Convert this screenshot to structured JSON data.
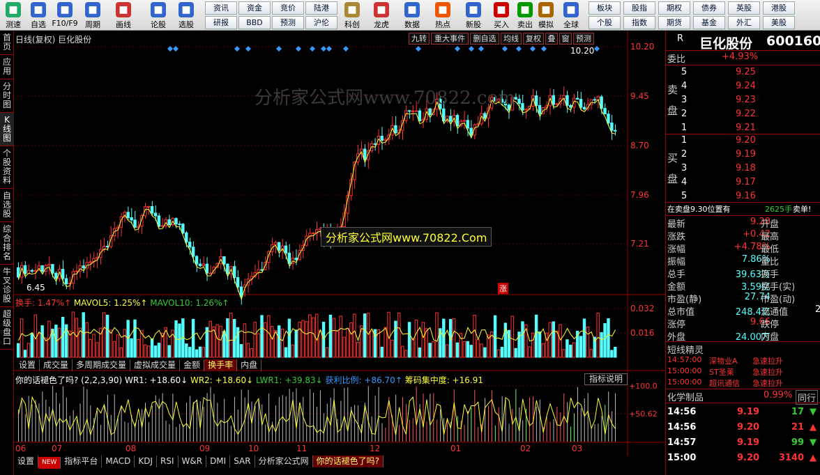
{
  "toolbar": {
    "items": [
      {
        "label": "测速",
        "icon": "speed-test-icon",
        "color": "#2a6"
      },
      {
        "label": "自选",
        "icon": "star-icon",
        "color": "#36c"
      },
      {
        "label": "F10/F9",
        "icon": "f10-icon",
        "color": "#36c"
      },
      {
        "label": "周期",
        "icon": "clock-icon",
        "color": "#36c"
      },
      {
        "label": "画线",
        "icon": "pencil-icon",
        "color": "#c33"
      },
      {
        "label": "论股",
        "icon": "forum-icon",
        "color": "#36c"
      },
      {
        "label": "选股",
        "icon": "stock-pick-icon",
        "color": "#36c"
      },
      {
        "label": "科创",
        "icon": "star-board-icon",
        "color": "#a83"
      },
      {
        "label": "龙虎",
        "icon": "dragon-tiger-icon",
        "color": "#c33"
      },
      {
        "label": "数据",
        "icon": "data-icon",
        "color": "#36c"
      },
      {
        "label": "热点",
        "icon": "hot-icon",
        "color": "#e50"
      },
      {
        "label": "新股",
        "icon": "ipo-icon",
        "color": "#36c"
      },
      {
        "label": "买入",
        "icon": "buy-icon",
        "color": "#c00"
      },
      {
        "label": "卖出",
        "icon": "sell-icon",
        "color": "#090"
      },
      {
        "label": "模拟",
        "icon": "simulate-icon",
        "color": "#a60"
      },
      {
        "label": "全球",
        "icon": "globe-icon",
        "color": "#36c"
      }
    ],
    "grid1": [
      [
        "资讯",
        "研报"
      ],
      [
        "资金",
        "BBD"
      ],
      [
        "竞价",
        "预测"
      ],
      [
        "陆港",
        "沪伦"
      ]
    ],
    "grid2": [
      [
        "板块",
        "个股"
      ],
      [
        "股指",
        "指数"
      ],
      [
        "期权",
        "期货"
      ],
      [
        "债券",
        "基金"
      ],
      [
        "英股",
        "外汇"
      ],
      [
        "港股",
        "美股"
      ]
    ]
  },
  "side_tabs": [
    "首页",
    "应用",
    "分时图",
    "K线图",
    "个股资料",
    "自选股",
    "综合排名",
    "牛叉诊股",
    "超级盘口"
  ],
  "chart_header": {
    "title": "日线(复权) 巨化股份",
    "buttons": [
      "九转",
      "重大事件",
      "删自选",
      "均线",
      "复权",
      "叠",
      "窗",
      "预测"
    ]
  },
  "watermark": "分析家公式网www.70822.com",
  "banner": "分析家公式网www.70822.Com",
  "zhang": "涨",
  "volume_legend": {
    "a": "换手: 1.47%↑",
    "b": "MAVOL5: 1.25%↑",
    "c": "MAVOL10: 1.26%↑"
  },
  "tabs1": [
    "设置",
    "成交量",
    "多周期成交量",
    "虚拟成交量",
    "金额",
    "换手率",
    "内盘"
  ],
  "ind_legend": {
    "a": "你的话褪色了吗? (2,2,3,90) WR1: +18.60↓",
    "b": "WR2: +18.60↓",
    "c": "LWR1: +39.83↓",
    "d": "获利比例: +86.70↑",
    "e": "筹码集中度: +16.91"
  },
  "ind_button": "指标说明",
  "tabs2": [
    "设置",
    "NEW",
    "指标平台",
    "MACD",
    "KDJ",
    "RSI",
    "W&R",
    "DMI",
    "SAR",
    "分析家公式网",
    "你的话褪色了吗?"
  ],
  "chart_data": {
    "type": "candlestick",
    "y_ticks": [
      "10.20",
      "9.45",
      "8.70",
      "7.96",
      "7.21"
    ],
    "price_max": "10.20",
    "price_min": "6.45",
    "vol_ticks": [
      "0.032",
      "0.016"
    ],
    "ind_ticks": [
      "+100.0",
      "+50.62"
    ],
    "x_months": [
      "06",
      "07",
      "08",
      "09",
      "10",
      "11",
      "12",
      "01",
      "02",
      "03"
    ]
  },
  "quote": {
    "letter": "R",
    "name": "巨化股份",
    "code": "600160",
    "weibi_label": "委比",
    "weibi": "+4.93%",
    "sell_label": [
      "卖",
      "盘"
    ],
    "buy_label": [
      "买",
      "盘"
    ],
    "sell": [
      [
        "5",
        "9.25"
      ],
      [
        "4",
        "9.24"
      ],
      [
        "3",
        "9.23"
      ],
      [
        "2",
        "9.22"
      ],
      [
        "1",
        "9.21"
      ]
    ],
    "buy": [
      [
        "1",
        "9.20"
      ],
      [
        "2",
        "9.19"
      ],
      [
        "3",
        "9.18"
      ],
      [
        "4",
        "9.17"
      ],
      [
        "5",
        "9.16"
      ]
    ],
    "notice": "在卖盘9.30位置有",
    "notice_vol": "2625手",
    "notice_act": "卖单!",
    "stats": [
      [
        "最新",
        "9.20",
        "开盘",
        ""
      ],
      [
        "涨跌",
        "+0.42",
        "最高",
        ""
      ],
      [
        "涨幅",
        "+4.78%",
        "最低",
        ""
      ],
      [
        "振幅",
        "7.86%",
        "量比",
        ""
      ],
      [
        "总手",
        "39.63万",
        "换手",
        ""
      ],
      [
        "金额",
        "3.59亿",
        "换手(实)",
        ""
      ],
      [
        "市盈(静)",
        "27.74",
        "市盈(动)",
        ""
      ],
      [
        "总市值",
        "248.4亿",
        "流通值",
        "2"
      ],
      [
        "涨停",
        "9.66",
        "跌停",
        ""
      ],
      [
        "外盘",
        "24.00万",
        "内盘",
        ""
      ]
    ],
    "spirit_title": "短线精灵",
    "spirit": [
      [
        "14:57:00",
        "深物业A",
        "急速拉升"
      ],
      [
        "15:00:00",
        "ST圣莱",
        "急速拉升"
      ],
      [
        "15:00:00",
        "超讯通信",
        "急速拉升"
      ]
    ],
    "sector": "化学制品",
    "sector_pct": "0.99%",
    "sector_btn": "同行",
    "ticks": [
      [
        "14:56",
        "9.19",
        "17"
      ],
      [
        "14:56",
        "9.20",
        "21"
      ],
      [
        "14:57",
        "9.19",
        "99"
      ],
      [
        "15:00",
        "9.20",
        "3140"
      ]
    ]
  }
}
